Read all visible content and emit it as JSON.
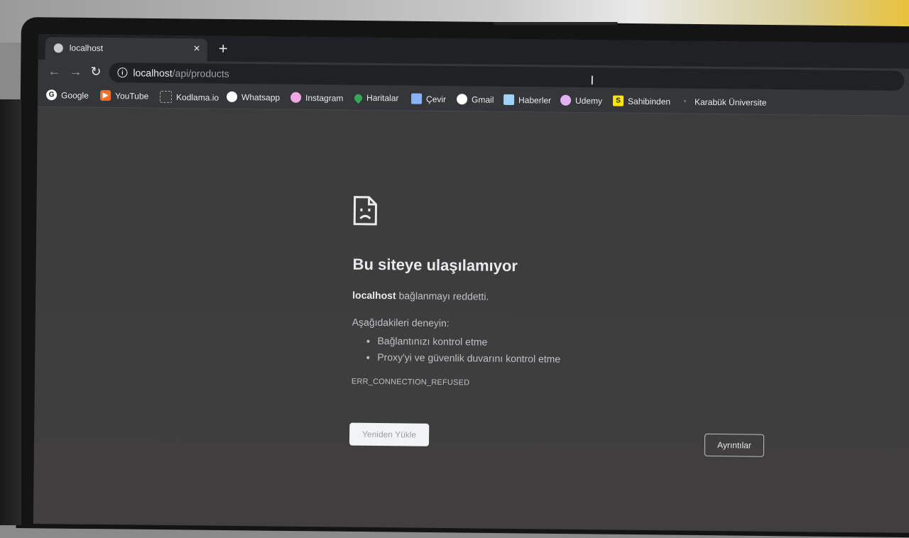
{
  "tab": {
    "title": "localhost",
    "close_glyph": "×",
    "new_tab_glyph": "+"
  },
  "toolbar": {
    "back_glyph": "←",
    "forward_glyph": "→",
    "reload_glyph": "↻",
    "url_host": "localhost",
    "url_path": "/api/products",
    "info_glyph": "i"
  },
  "bookmarks": [
    {
      "label": "Google",
      "icon": "google-icon",
      "color": "#ffffff",
      "glyph": "G"
    },
    {
      "label": "YouTube",
      "icon": "youtube-icon",
      "color": "#ff6a2a",
      "glyph": "▶"
    },
    {
      "label": "Kodlama.io",
      "icon": "kodlama-icon",
      "color": "#3a3a3a",
      "glyph": ""
    },
    {
      "label": "Whatsapp",
      "icon": "whatsapp-icon",
      "color": "#ffffff",
      "glyph": ""
    },
    {
      "label": "Instagram",
      "icon": "instagram-icon",
      "color": "#f3a6e6",
      "glyph": ""
    },
    {
      "label": "Haritalar",
      "icon": "maps-icon",
      "color": "#34a853",
      "glyph": ""
    },
    {
      "label": "Çevir",
      "icon": "translate-icon",
      "color": "#8ab4f8",
      "glyph": ""
    },
    {
      "label": "Gmail",
      "icon": "gmail-icon",
      "color": "#ffffff",
      "glyph": ""
    },
    {
      "label": "Haberler",
      "icon": "news-icon",
      "color": "#9fd3f7",
      "glyph": ""
    },
    {
      "label": "Udemy",
      "icon": "udemy-icon",
      "color": "#e3b0f5",
      "glyph": ""
    },
    {
      "label": "Sahibinden",
      "icon": "sahibinden-icon",
      "color": "#ffe600",
      "glyph": "S"
    },
    {
      "label": "Karabük Üniversite",
      "icon": "karabuk-icon",
      "color": "#35363a",
      "glyph": ""
    }
  ],
  "error": {
    "heading": "Bu siteye ulaşılamıyor",
    "summary_host": "localhost",
    "summary_text": " bağlanmayı reddetti.",
    "suggest_title": "Aşağıdakileri deneyin:",
    "suggestions": [
      "Bağlantınızı kontrol etme",
      "Proxy'yi ve güvenlik duvarını kontrol etme"
    ],
    "code": "ERR_CONNECTION_REFUSED",
    "reload_label": "Yeniden Yükle",
    "details_label": "Ayrıntılar"
  }
}
